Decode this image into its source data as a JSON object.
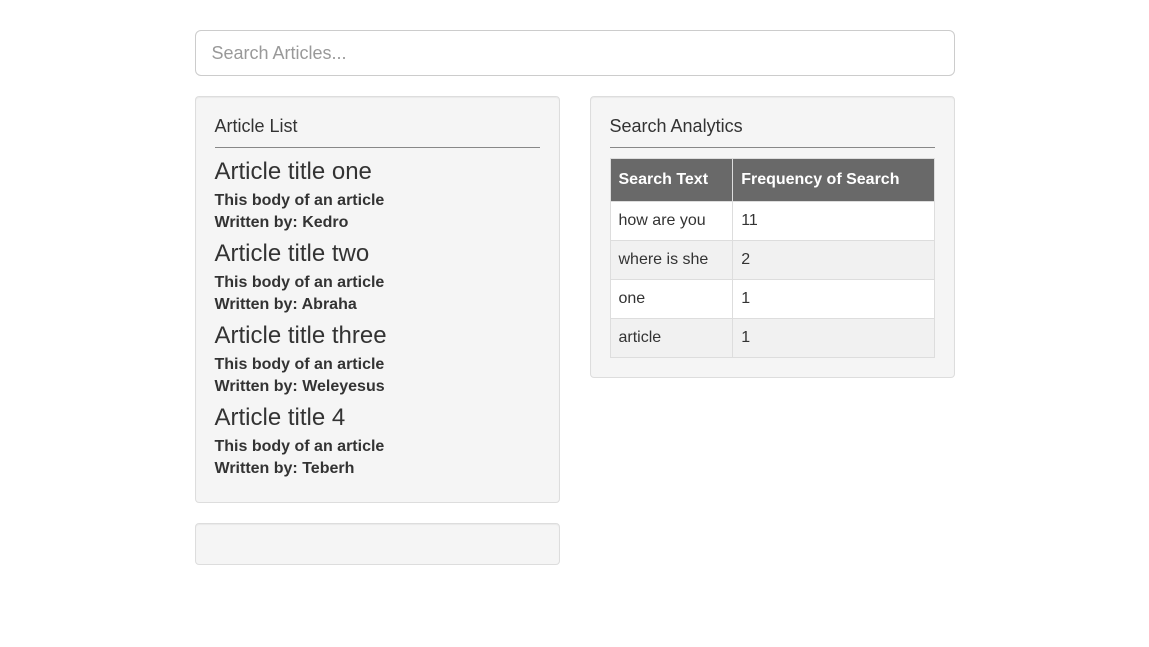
{
  "search": {
    "placeholder": "Search Articles...",
    "value": ""
  },
  "articleList": {
    "heading": "Article List",
    "authorPrefix": "Written by: ",
    "articles": [
      {
        "title": "Article title one",
        "body": "This body of an article",
        "author": "Kedro"
      },
      {
        "title": "Article title two",
        "body": "This body of an article",
        "author": "Abraha"
      },
      {
        "title": "Article title three",
        "body": "This body of an article",
        "author": "Weleyesus"
      },
      {
        "title": "Article title 4",
        "body": "This body of an article",
        "author": "Teberh"
      }
    ]
  },
  "analytics": {
    "heading": "Search Analytics",
    "columns": [
      "Search Text",
      "Frequency of Search"
    ],
    "rows": [
      {
        "text": "how are you",
        "frequency": "11"
      },
      {
        "text": "where is she",
        "frequency": "2"
      },
      {
        "text": "one",
        "frequency": "1"
      },
      {
        "text": "article",
        "frequency": "1"
      }
    ]
  }
}
